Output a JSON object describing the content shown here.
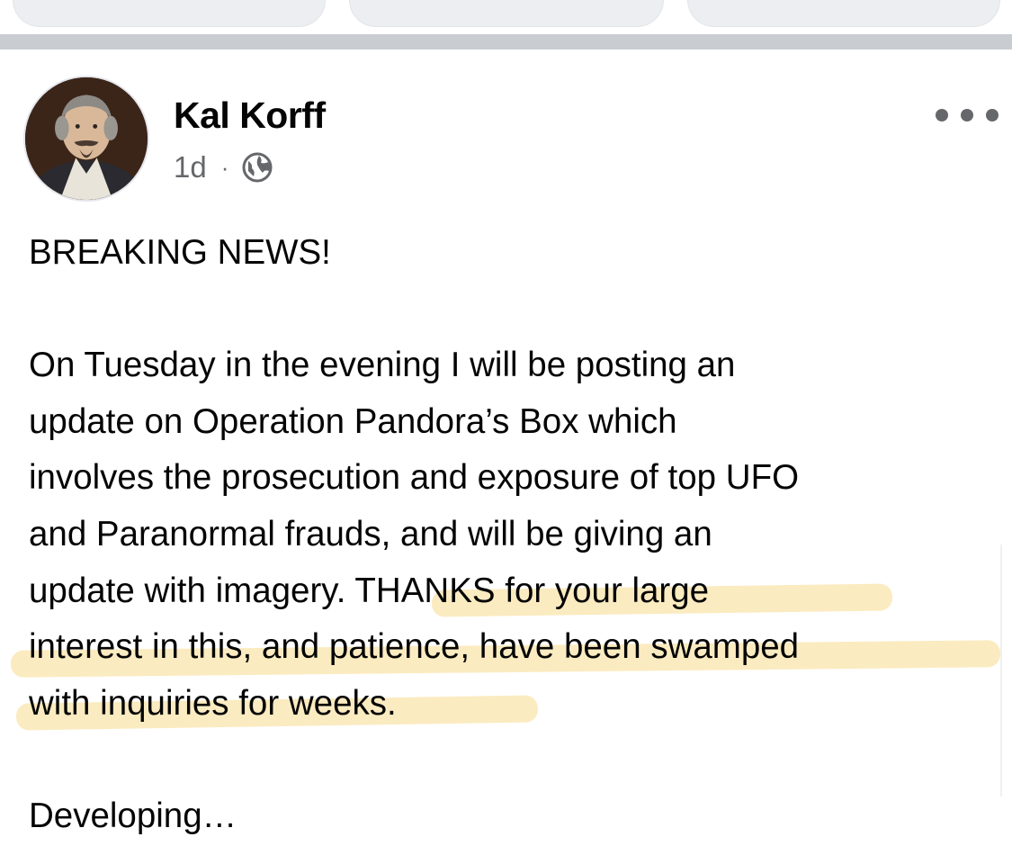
{
  "post": {
    "author": {
      "name": "Kal Korff"
    },
    "time": "1d",
    "separator": "·",
    "privacy_icon": "globe-icon",
    "more_icon": "more-options-icon",
    "body": {
      "headline": "BREAKING NEWS!",
      "paragraph_lines": [
        "On Tuesday in the evening I will be posting an",
        "update on Operation Pandora’s Box which",
        "involves the prosecution and exposure of top UFO",
        "and Paranormal frauds, and will be giving an",
        "update with imagery. THANKS for your large",
        "interest in this, and patience, have been swamped",
        "with inquiries for weeks."
      ],
      "closing": "Developing…"
    }
  },
  "colors": {
    "text_primary": "#050505",
    "text_secondary": "#65676b",
    "divider": "#c9ccd1",
    "highlight": "#f7da8c"
  }
}
